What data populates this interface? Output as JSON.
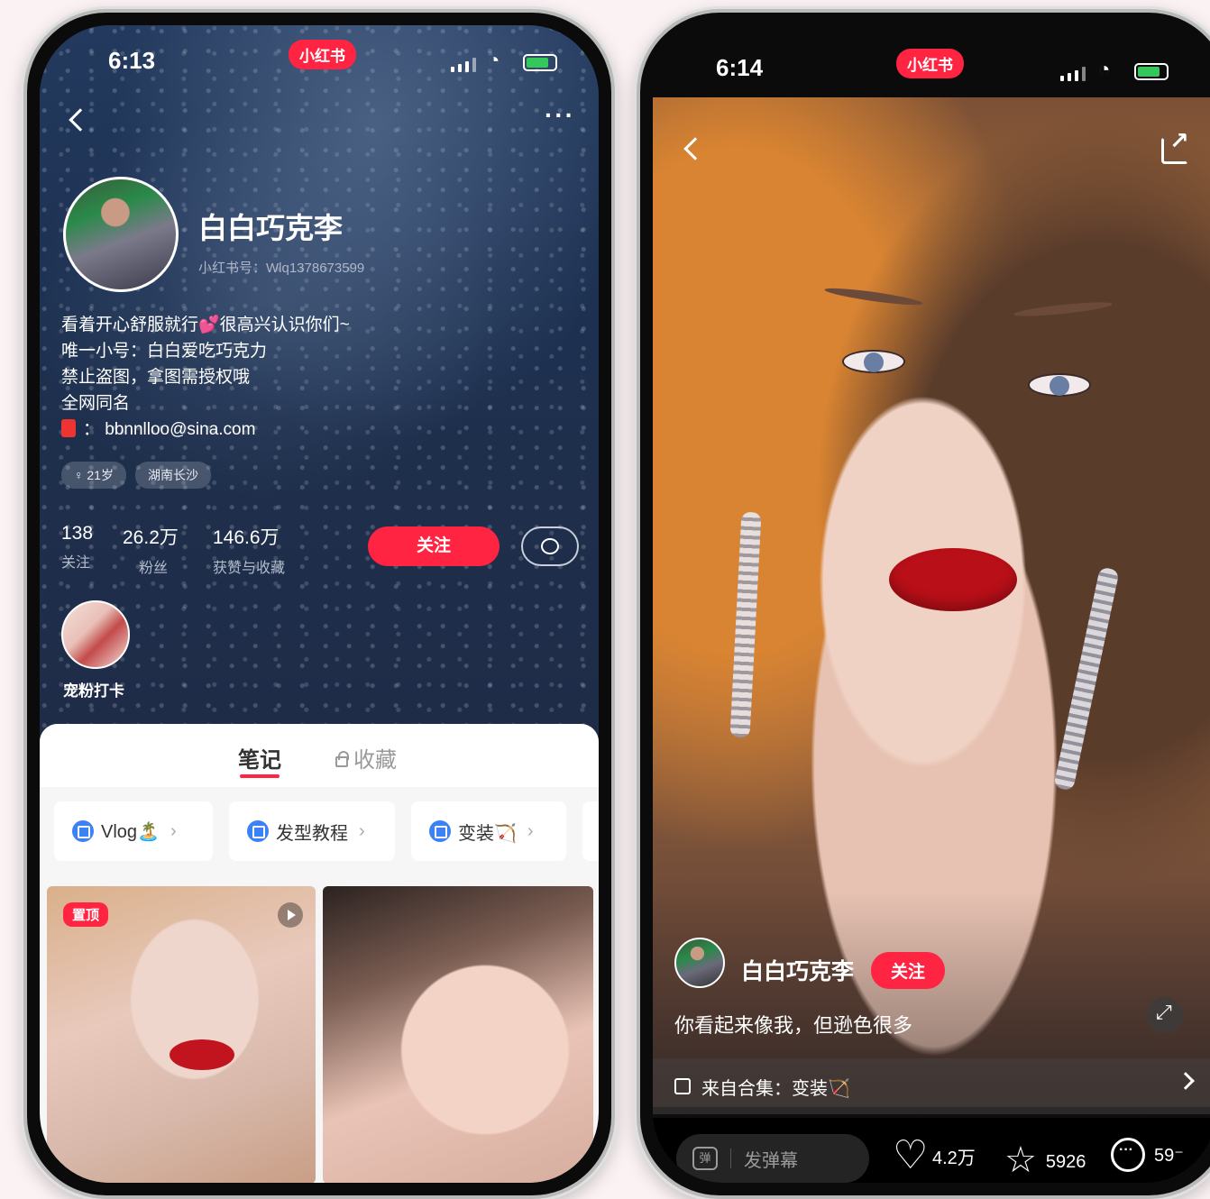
{
  "left": {
    "status": {
      "time": "6:13",
      "brand": "小红书"
    },
    "profile": {
      "name": "白白巧克李",
      "red_id": "小红书号：Wlq1378673599",
      "bio": [
        "看着开心舒服就行💕很高兴认识你们~",
        "唯一小号：白白爱吃巧克力",
        "禁止盗图，拿图需授权哦",
        "全网同名"
      ],
      "email": "：  bbnnlloo@sina.com",
      "tags": [
        "♀ 21岁",
        "湖南长沙"
      ]
    },
    "stats": [
      {
        "num": "138",
        "label": "关注"
      },
      {
        "num": "26.2万",
        "label": "粉丝"
      },
      {
        "num": "146.6万",
        "label": "获赞与收藏"
      }
    ],
    "follow_label": "关注",
    "fan_card_label": "宠粉打卡",
    "tabs": {
      "notes": "笔记",
      "saved": "收藏"
    },
    "collections": [
      {
        "label": "Vlog🏝️"
      },
      {
        "label": "发型教程"
      },
      {
        "label": "变装🏹"
      }
    ],
    "pin_label": "置顶"
  },
  "right": {
    "status": {
      "time": "6:14",
      "brand": "小红书"
    },
    "author": "白白巧克李",
    "follow_label": "关注",
    "caption": "你看起来像我，但逊色很多",
    "collection": "来自合集：变装🏹",
    "danmu": {
      "icon": "弹",
      "placeholder": "发弹幕"
    },
    "likes": "4.2万",
    "stars": "5926",
    "comments": "59⁻"
  },
  "colors": {
    "brand_red": "#ff2442",
    "navy": "#1f2d4a"
  }
}
